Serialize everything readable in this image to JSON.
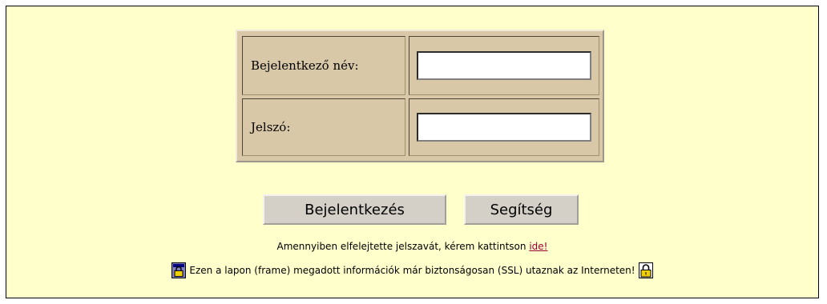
{
  "login": {
    "username_label": "Bejelentkező név:",
    "username_value": "",
    "password_label": "Jelszó:",
    "password_value": ""
  },
  "buttons": {
    "login_label": "Bejelentkezés",
    "help_label": "Segítség"
  },
  "forgot": {
    "text": "Amennyiben elfelejtette jelszavát, kérem kattintson",
    "link_label": "ide!"
  },
  "ssl": {
    "text": "Ezen a lapon (frame) megadott információk már biztonságosan (SSL) utaznak az Interneten!"
  },
  "colors": {
    "page_background": "#ffffcc",
    "table_background": "#d8c8a8",
    "button_face": "#d4d0c8",
    "link": "#990033"
  },
  "icons": {
    "left": "lock-icon",
    "right": "padlock-icon"
  }
}
